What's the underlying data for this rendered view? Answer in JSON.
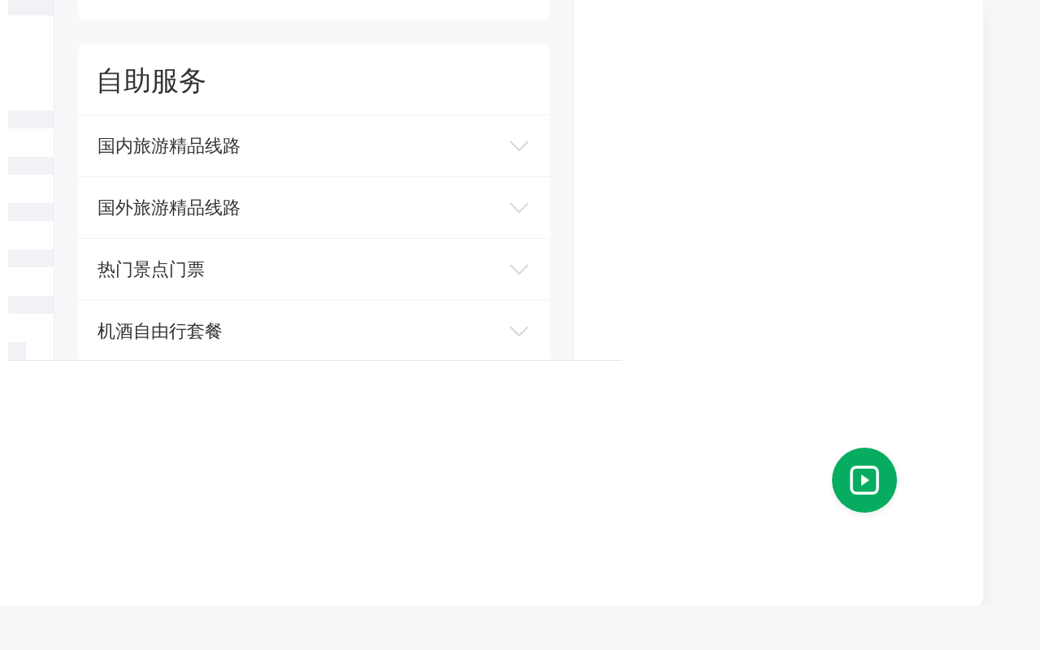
{
  "service_card": {
    "title": "自助服务",
    "items": [
      {
        "label": "国内旅游精品线路",
        "expanded": false
      },
      {
        "label": "国外旅游精品线路",
        "expanded": false
      },
      {
        "label": "热门景点门票",
        "expanded": false
      },
      {
        "label": "机酒自由行套餐",
        "expanded": false
      }
    ]
  },
  "floating_button": {
    "kind": "play"
  }
}
